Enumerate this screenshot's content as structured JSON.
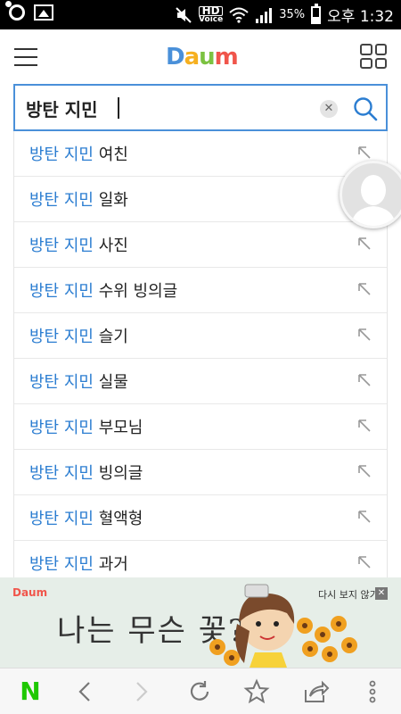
{
  "status_bar": {
    "hd_label": "HD",
    "voice_label": "Voice",
    "battery": "35%",
    "time": "오후 1:32",
    "icons": [
      "camera-ring-icon",
      "gallery-icon",
      "mute-icon",
      "wifi-icon",
      "signal-icon",
      "battery-icon"
    ]
  },
  "header": {
    "menu_icon": "hamburger-icon",
    "logo": [
      "D",
      "a",
      "u",
      "m"
    ],
    "apps_icon": "grid-icon"
  },
  "search": {
    "query": "방탄 지민",
    "clear_label": "✕",
    "search_icon": "search-icon"
  },
  "suggestions": [
    {
      "prefix": "방탄 지민",
      "suffix": " 여친"
    },
    {
      "prefix": "방탄 지민",
      "suffix": " 일화"
    },
    {
      "prefix": "방탄 지민",
      "suffix": " 사진"
    },
    {
      "prefix": "방탄 지민",
      "suffix": " 수위 빙의글"
    },
    {
      "prefix": "방탄 지민",
      "suffix": " 슬기"
    },
    {
      "prefix": "방탄 지민",
      "suffix": " 실물"
    },
    {
      "prefix": "방탄 지민",
      "suffix": " 부모님"
    },
    {
      "prefix": "방탄 지민",
      "suffix": " 빙의글"
    },
    {
      "prefix": "방탄 지민",
      "suffix": " 혈액형"
    },
    {
      "prefix": "방탄 지민",
      "suffix": " 과거"
    }
  ],
  "ad": {
    "logo": "Daum",
    "dismiss_label": "다시 보지 않기",
    "close_label": "✕",
    "text": "나는 무슨 꽃?"
  },
  "bottom_nav": {
    "items": [
      "naver-n-icon",
      "back-icon",
      "forward-icon",
      "refresh-icon",
      "bookmark-star-icon",
      "share-icon",
      "more-icon"
    ],
    "n_label": "N"
  },
  "colors": {
    "accent": "#4a90d9",
    "highlight": "#2b7dd1",
    "logo": [
      "#f0554b",
      "#4a90d9",
      "#7cc241",
      "#f6b020"
    ]
  }
}
